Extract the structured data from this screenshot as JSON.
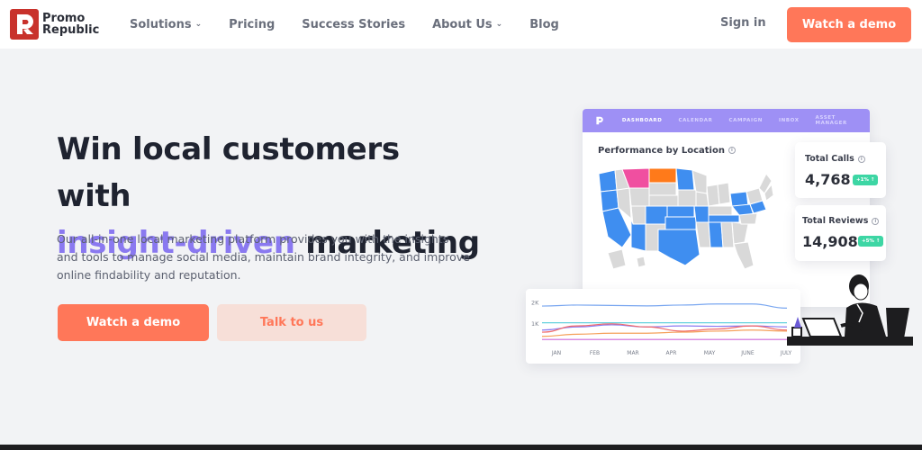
{
  "nav": {
    "logo": {
      "line1": "Promo",
      "line2": "Republic"
    },
    "links": [
      {
        "label": "Solutions",
        "dropdown": true
      },
      {
        "label": "Pricing",
        "dropdown": false
      },
      {
        "label": "Success Stories",
        "dropdown": false
      },
      {
        "label": "About Us",
        "dropdown": true
      },
      {
        "label": "Blog",
        "dropdown": false
      }
    ],
    "sign_in": "Sign in",
    "cta": "Watch a demo"
  },
  "hero": {
    "title_line1": "Win local customers with",
    "title_accent": "insight-driven",
    "title_rest": " marketing",
    "subtitle": "Our all-in-one local marketing platform provides you with the insights and tools to manage social media, maintain brand integrity, and improve online findability and reputation.",
    "primary_button": "Watch a demo",
    "secondary_button": "Talk to us"
  },
  "dashboard": {
    "tabs": [
      "DASHBOARD",
      "CALENDAR",
      "CAMPAIGN",
      "INBOX",
      "ASSET MANAGER"
    ],
    "active_tab": "DASHBOARD",
    "map_title": "Performance by Location",
    "stats": [
      {
        "label": "Total Calls",
        "value": "4,768",
        "badge": "+1% ↑"
      },
      {
        "label": "Total Reviews",
        "value": "14,908",
        "badge": "+5% ↑"
      }
    ]
  },
  "colors": {
    "accent": "#ff7759",
    "purple": "#8a79f0",
    "map_blue": "#3f8ef0",
    "map_pink": "#f04fa0",
    "map_orange": "#ff7a1a"
  },
  "chart_data": {
    "type": "line",
    "categories": [
      "JAN",
      "FEB",
      "MAR",
      "APR",
      "MAY",
      "JUNE",
      "JULY"
    ],
    "ytick_labels": [
      "2K",
      "1K"
    ],
    "series": [
      {
        "color": "#7aa7f0",
        "values": [
          1850,
          1900,
          1880,
          1860,
          1900,
          1950,
          1950,
          1750
        ]
      },
      {
        "color": "#66d2dd",
        "values": [
          1050,
          1050,
          1050,
          1050,
          1050,
          1050,
          1050,
          1050
        ]
      },
      {
        "color": "#8b7bf0",
        "values": [
          700,
          850,
          950,
          850,
          900,
          880,
          900,
          850
        ]
      },
      {
        "color": "#f06a6a",
        "values": [
          600,
          900,
          1000,
          850,
          650,
          750,
          900,
          700
        ]
      },
      {
        "color": "#f5a05a",
        "values": [
          400,
          500,
          550,
          550,
          600,
          650,
          700,
          650
        ]
      },
      {
        "color": "#cc66d8",
        "values": [
          250,
          250,
          250,
          250,
          250,
          250,
          250,
          250
        ]
      }
    ],
    "ylim": [
      0,
      2500
    ]
  }
}
